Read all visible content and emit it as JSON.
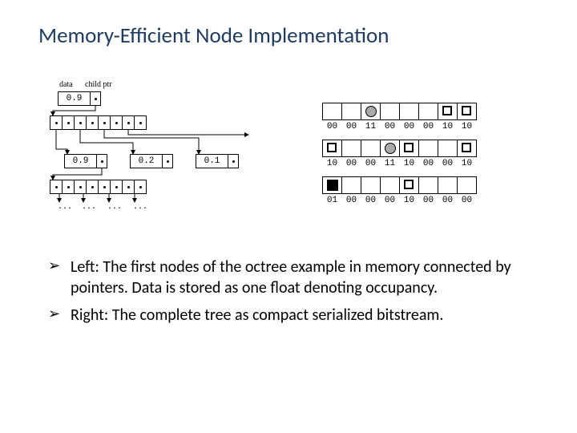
{
  "title": "Memory-Efficient Node Implementation",
  "left_diagram": {
    "header_data": "data",
    "header_ptr": "child ptr",
    "node1": {
      "value": "0.9"
    },
    "node2a": {
      "value": "0.9"
    },
    "node2b": {
      "value": "0.2"
    },
    "node2c": {
      "value": "0.1"
    },
    "ellipsis": "..."
  },
  "right_diagram": {
    "rows": [
      {
        "cells": [
          "",
          "",
          "circle-gray",
          "",
          "",
          "",
          "sq-outline",
          "sq-outline"
        ],
        "bits": [
          "00",
          "00",
          "11",
          "00",
          "00",
          "00",
          "10",
          "10"
        ]
      },
      {
        "cells": [
          "sq-outline",
          "",
          "",
          "circle-gray",
          "sq-outline",
          "",
          "",
          "sq-outline"
        ],
        "bits": [
          "10",
          "00",
          "00",
          "11",
          "10",
          "00",
          "00",
          "10"
        ]
      },
      {
        "cells": [
          "sq-black",
          "",
          "",
          "",
          "sq-outline",
          "",
          "",
          ""
        ],
        "bits": [
          "01",
          "00",
          "00",
          "00",
          "10",
          "00",
          "00",
          "00"
        ]
      }
    ]
  },
  "bullets": [
    "Left: The first nodes of the octree example in memory connected by pointers. Data is stored as one float denoting occupancy.",
    "Right: The complete tree as compact serialized bitstream."
  ]
}
